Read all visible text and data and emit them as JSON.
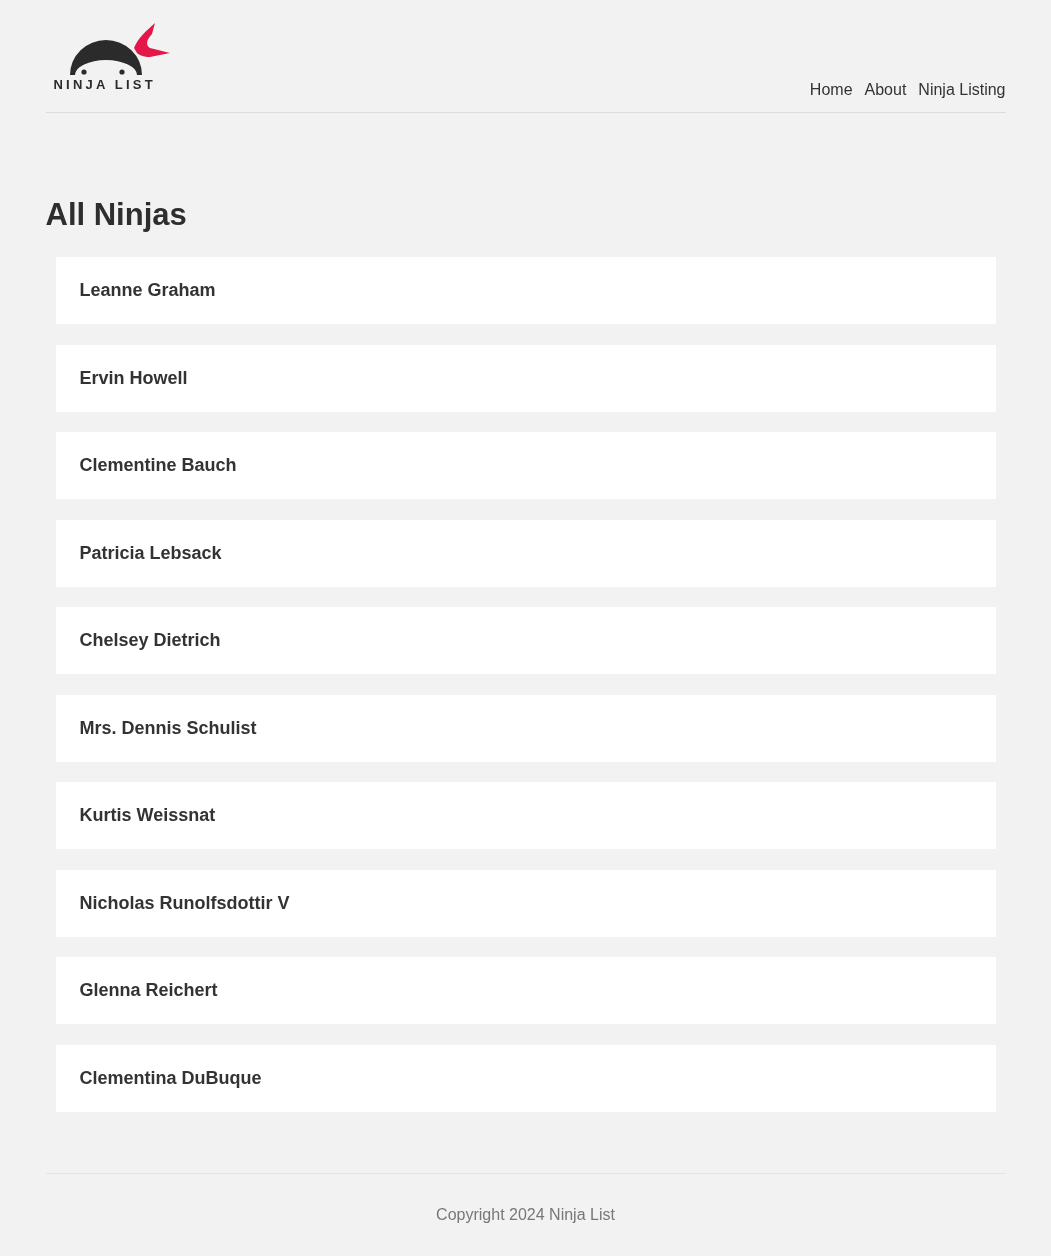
{
  "logo": {
    "text": "NINJA LIST"
  },
  "nav": {
    "links": [
      "Home",
      "About",
      "Ninja Listing"
    ]
  },
  "heading": "All Ninjas",
  "ninjas": [
    "Leanne Graham",
    "Ervin Howell",
    "Clementine Bauch",
    "Patricia Lebsack",
    "Chelsey Dietrich",
    "Mrs. Dennis Schulist",
    "Kurtis Weissnat",
    "Nicholas Runolfsdottir V",
    "Glenna Reichert",
    "Clementina DuBuque"
  ],
  "footer": {
    "text": "Copyright 2024 Ninja List"
  }
}
